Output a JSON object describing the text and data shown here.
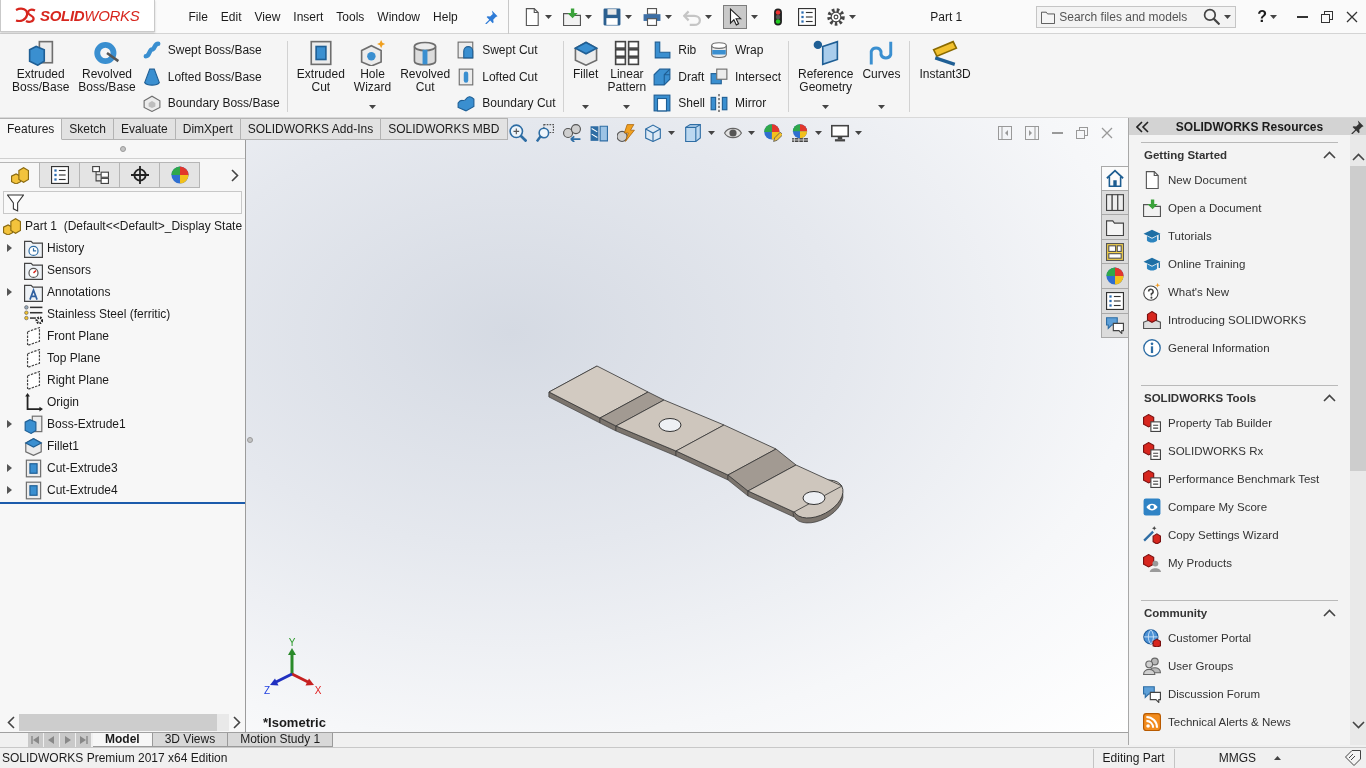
{
  "title_bar": {
    "logo": "**SOLID**WORKS",
    "menu": [
      "File",
      "Edit",
      "View",
      "Insert",
      "Tools",
      "Window",
      "Help"
    ],
    "document_title": "Part 1",
    "search": {
      "placeholder": "Search files and models"
    },
    "help": "?"
  },
  "quick_access_toolbar": [
    {
      "dropdown": true,
      "selected": false,
      "disabled": false
    },
    {
      "dropdown": true,
      "selected": false,
      "disabled": false
    },
    {
      "dropdown": true,
      "selected": false,
      "disabled": false
    },
    {
      "dropdown": true,
      "selected": false,
      "disabled": false
    },
    {
      "dropdown": true,
      "selected": false,
      "disabled": true
    },
    {
      "dropdown": true,
      "selected": true,
      "disabled": false
    },
    {
      "dropdown": false,
      "selected": false,
      "disabled": false
    },
    {
      "dropdown": false,
      "selected": false,
      "disabled": false
    },
    {
      "dropdown": true,
      "selected": false,
      "disabled": false
    }
  ],
  "ribbon": {
    "groups": [
      {
        "columns": [
          {
            "kind": "large",
            "tools": [
              {
                "label": "Extruded Boss/Base",
                "dropdown": false
              }
            ]
          },
          {
            "kind": "large",
            "tools": [
              {
                "label": "Revolved Boss/Base",
                "dropdown": false
              }
            ]
          },
          {
            "kind": "stack",
            "tools": [
              {
                "label": "Swept Boss/Base"
              },
              {
                "label": "Lofted Boss/Base"
              },
              {
                "label": "Boundary Boss/Base"
              }
            ]
          }
        ]
      },
      {
        "columns": [
          {
            "kind": "large",
            "tools": [
              {
                "label": "Extruded Cut",
                "dropdown": false
              }
            ]
          },
          {
            "kind": "large",
            "tools": [
              {
                "label": "Hole Wizard",
                "dropdown": true
              }
            ]
          },
          {
            "kind": "large",
            "tools": [
              {
                "label": "Revolved Cut",
                "dropdown": false
              }
            ]
          },
          {
            "kind": "stack",
            "tools": [
              {
                "label": "Swept Cut"
              },
              {
                "label": "Lofted Cut"
              },
              {
                "label": "Boundary Cut"
              }
            ]
          }
        ]
      },
      {
        "columns": [
          {
            "kind": "large",
            "tools": [
              {
                "label": "Fillet",
                "dropdown": true
              }
            ]
          },
          {
            "kind": "large",
            "tools": [
              {
                "label": "Linear Pattern",
                "dropdown": true
              }
            ]
          },
          {
            "kind": "stack",
            "tools": [
              {
                "label": "Rib"
              },
              {
                "label": "Draft"
              },
              {
                "label": "Shell"
              }
            ]
          },
          {
            "kind": "stack",
            "tools": [
              {
                "label": "Wrap"
              },
              {
                "label": "Intersect"
              },
              {
                "label": "Mirror"
              }
            ]
          }
        ]
      },
      {
        "columns": [
          {
            "kind": "large",
            "tools": [
              {
                "label": "Reference Geometry",
                "dropdown": true
              }
            ]
          },
          {
            "kind": "large",
            "tools": [
              {
                "label": "Curves",
                "dropdown": true
              }
            ]
          }
        ]
      },
      {
        "columns": [
          {
            "kind": "large",
            "tools": [
              {
                "label": "Instant3D",
                "dropdown": false
              }
            ]
          }
        ]
      }
    ]
  },
  "command_tabs": [
    {
      "label": "Features",
      "selected": true
    },
    {
      "label": "Sketch",
      "selected": false
    },
    {
      "label": "Evaluate",
      "selected": false
    },
    {
      "label": "DimXpert",
      "selected": false
    },
    {
      "label": "SOLIDWORKS Add-Ins",
      "selected": false
    },
    {
      "label": "SOLIDWORKS MBD",
      "selected": false
    }
  ],
  "view_toolbar": [
    {
      "dropdown": false
    },
    {
      "dropdown": false
    },
    {
      "dropdown": false
    },
    {
      "dropdown": false
    },
    {
      "dropdown": false
    },
    {
      "dropdown": true
    },
    {
      "dropdown": true
    },
    {
      "dropdown": true
    },
    {
      "dropdown": false
    },
    {
      "dropdown": true
    },
    {
      "dropdown": true
    }
  ],
  "feature_manager": {
    "panel_tabs": [
      {
        "selected": true
      },
      {
        "selected": false
      },
      {
        "selected": false
      },
      {
        "selected": false
      },
      {
        "selected": false
      }
    ],
    "root": "Part 1  (Default<<Default>_Display State",
    "items": [
      {
        "label": "History",
        "kind": "history",
        "expandable": true
      },
      {
        "label": "Sensors",
        "kind": "sensors",
        "expandable": false
      },
      {
        "label": "Annotations",
        "kind": "annotations",
        "expandable": true
      },
      {
        "label": "Stainless Steel (ferritic)",
        "kind": "material",
        "expandable": false
      },
      {
        "label": "Front Plane",
        "kind": "plane",
        "expandable": false
      },
      {
        "label": "Top Plane",
        "kind": "plane",
        "expandable": false
      },
      {
        "label": "Right Plane",
        "kind": "plane",
        "expandable": false
      },
      {
        "label": "Origin",
        "kind": "origin",
        "expandable": false
      },
      {
        "label": "Boss-Extrude1",
        "kind": "extrude",
        "expandable": true
      },
      {
        "label": "Fillet1",
        "kind": "fillet",
        "expandable": false
      },
      {
        "label": "Cut-Extrude3",
        "kind": "cut",
        "expandable": true
      },
      {
        "label": "Cut-Extrude4",
        "kind": "cut",
        "expandable": true
      }
    ]
  },
  "graphics": {
    "triad": {
      "x": "X",
      "y": "Y",
      "z": "Z"
    },
    "view_label": "*Isometric"
  },
  "task_pane_tabs": [
    {
      "selected": true
    },
    {
      "selected": false
    },
    {
      "selected": false
    },
    {
      "selected": false
    },
    {
      "selected": false
    },
    {
      "selected": false
    },
    {
      "selected": false
    }
  ],
  "resources": {
    "title": "SOLIDWORKS Resources",
    "sections": [
      {
        "title": "Getting Started",
        "expanded": true,
        "links": [
          "New Document",
          "Open a Document",
          "Tutorials",
          "Online Training",
          "What's New",
          "Introducing SOLIDWORKS",
          "General Information"
        ]
      },
      {
        "title": "SOLIDWORKS Tools",
        "expanded": true,
        "links": [
          "Property Tab Builder",
          "SOLIDWORKS Rx",
          "Performance Benchmark Test",
          "Compare My Score",
          "Copy Settings Wizard",
          "My Products"
        ]
      },
      {
        "title": "Community",
        "expanded": true,
        "links": [
          "Customer Portal",
          "User Groups",
          "Discussion Forum",
          "Technical Alerts & News"
        ]
      }
    ]
  },
  "model_tabs": [
    {
      "label": "Model",
      "selected": true
    },
    {
      "label": "3D Views",
      "selected": false
    },
    {
      "label": "Motion Study 1",
      "selected": false
    }
  ],
  "status_bar": {
    "product": "SOLIDWORKS Premium 2017 x64 Edition",
    "mode": "Editing Part",
    "units": "MMGS"
  }
}
